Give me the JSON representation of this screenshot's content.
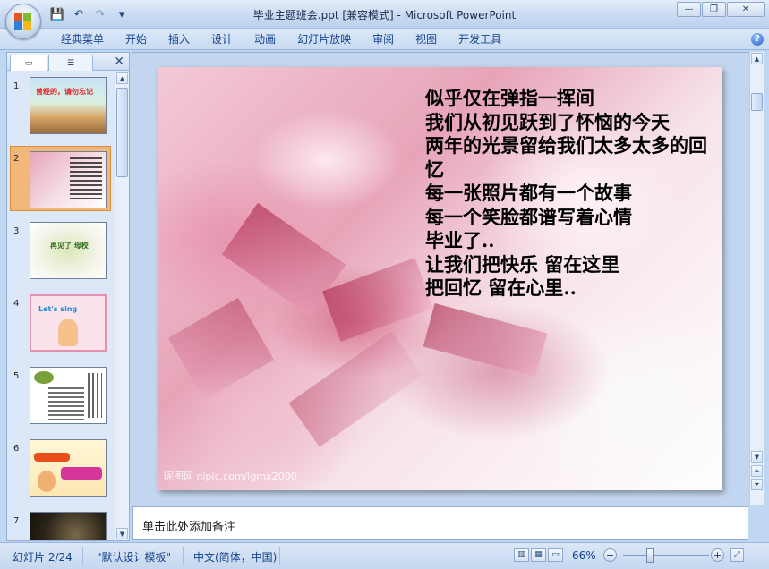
{
  "window": {
    "title": "毕业主题班会.ppt [兼容模式] - Microsoft PowerPoint",
    "minimize_label": "—",
    "restore_label": "❐",
    "close_label": "✕"
  },
  "quick_access": {
    "save_icon": "💾",
    "undo_icon": "↶",
    "redo_icon": "↷",
    "customize_icon": "▾"
  },
  "ribbon": {
    "tabs": [
      {
        "label": "经典菜单"
      },
      {
        "label": "开始"
      },
      {
        "label": "插入"
      },
      {
        "label": "设计"
      },
      {
        "label": "动画"
      },
      {
        "label": "幻灯片放映"
      },
      {
        "label": "审阅"
      },
      {
        "label": "视图"
      },
      {
        "label": "开发工具"
      }
    ],
    "help_icon": "?"
  },
  "thumbnails": {
    "close_label": "✕",
    "items": [
      {
        "number": "1",
        "caption": "曾经的，请勿忘记"
      },
      {
        "number": "2",
        "caption": ""
      },
      {
        "number": "3",
        "caption": "再见了 母校"
      },
      {
        "number": "4",
        "caption": "Let's sing"
      },
      {
        "number": "5",
        "caption": ""
      },
      {
        "number": "6",
        "caption": ""
      },
      {
        "number": "7",
        "caption": ""
      }
    ],
    "selected_index": 1
  },
  "slide": {
    "lines": [
      "似乎仅在弹指一挥间",
      "我们从初见跃到了怀恼的今天",
      "两年的光景留给我们太多太多的回忆",
      "每一张照片都有一个故事",
      "每一个笑脸都谱写着心情",
      "毕业了..",
      "让我们把快乐 留在这里",
      "把回忆 留在心里.."
    ],
    "watermark": "昵图网 nipic.com/lgmx2000"
  },
  "notes": {
    "placeholder": "单击此处添加备注"
  },
  "statusbar": {
    "slide_counter": "幻灯片 2/24",
    "template": "\"默认设计模板\"",
    "language": "中文(简体，中国)",
    "zoom_percent": "66%",
    "zoom_value": 0.66
  },
  "colors": {
    "ribbon_bg": "#c9dbf2",
    "selected_thumb": "#f2b87a"
  }
}
